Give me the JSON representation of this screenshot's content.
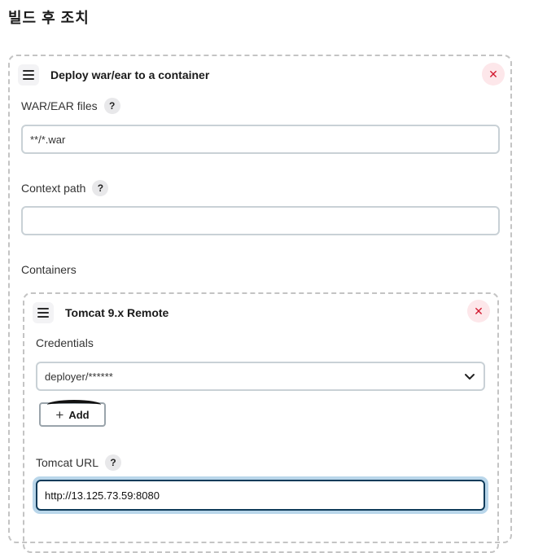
{
  "section": {
    "title": "빌드 후 조치"
  },
  "deploy": {
    "title": "Deploy war/ear to a container",
    "close_icon": "close-icon",
    "war_files": {
      "label": "WAR/EAR files",
      "help": "?",
      "value": "**/*.war"
    },
    "context_path": {
      "label": "Context path",
      "help": "?",
      "value": ""
    },
    "containers_label": "Containers"
  },
  "container": {
    "title": "Tomcat 9.x Remote",
    "credentials": {
      "label": "Credentials",
      "selected": "deployer/******"
    },
    "add_button": {
      "label": "Add",
      "icon": "plus-icon"
    },
    "tomcat_url": {
      "label": "Tomcat URL",
      "help": "?",
      "value": "http://13.125.73.59:8080"
    }
  },
  "colors": {
    "close_bg": "#fde7ea",
    "close_fg": "#d2182e",
    "focus_ring": "#b9d6ea",
    "focus_border": "#0f3b5a"
  }
}
